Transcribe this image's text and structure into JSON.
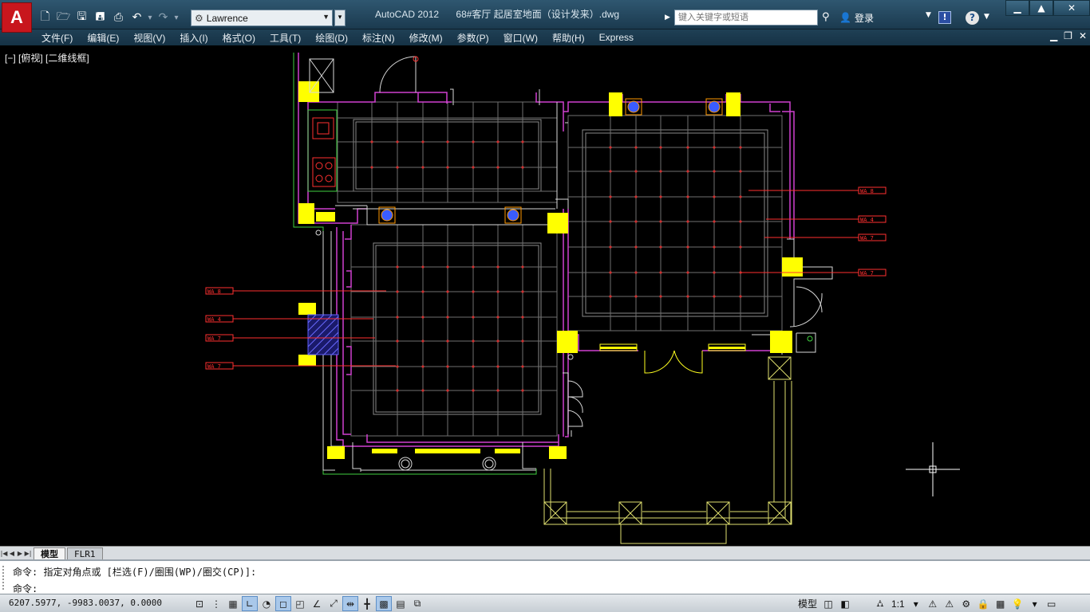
{
  "app": {
    "logo_letter": "A",
    "title_app": "AutoCAD 2012",
    "title_file": "68#客厅 起居室地面（设计发来）.dwg"
  },
  "quick_access": {
    "icons": [
      "new-file-icon",
      "open-file-icon",
      "save-icon",
      "save-as-icon",
      "print-icon",
      "undo-icon",
      "redo-icon"
    ],
    "workspace": "Lawrence"
  },
  "infocenter": {
    "search_placeholder": "键入关键字或短语",
    "login_label": "登录"
  },
  "menu": {
    "items": [
      "文件(F)",
      "编辑(E)",
      "视图(V)",
      "插入(I)",
      "格式(O)",
      "工具(T)",
      "绘图(D)",
      "标注(N)",
      "修改(M)",
      "参数(P)",
      "窗口(W)",
      "帮助(H)",
      "Express"
    ]
  },
  "viewport": {
    "label": "[−] [俯视] [二维线框]"
  },
  "drawing": {
    "tag_labels": [
      "WA 8",
      "WA 4",
      "WA 7",
      "WA 7",
      "WA 8",
      "WA 4",
      "WA 7",
      "WA 7"
    ]
  },
  "tabs": {
    "items": [
      "模型",
      "FLR1"
    ],
    "active": "模型"
  },
  "command": {
    "history": "命令: 指定对角点或 [栏选(F)/圈围(WP)/圈交(CP)]:",
    "prompt": "命令:"
  },
  "status": {
    "coordinates": "6207.5977, -9983.0037, 0.0000",
    "model_label": "模型",
    "annotation_scale": "1:1"
  },
  "colors": {
    "wall_magenta": "#d040d0",
    "column_yellow": "#ffff00",
    "grid_gray": "#7a7a7a",
    "tag_red": "#ff2020",
    "outline_green": "#40d040"
  }
}
